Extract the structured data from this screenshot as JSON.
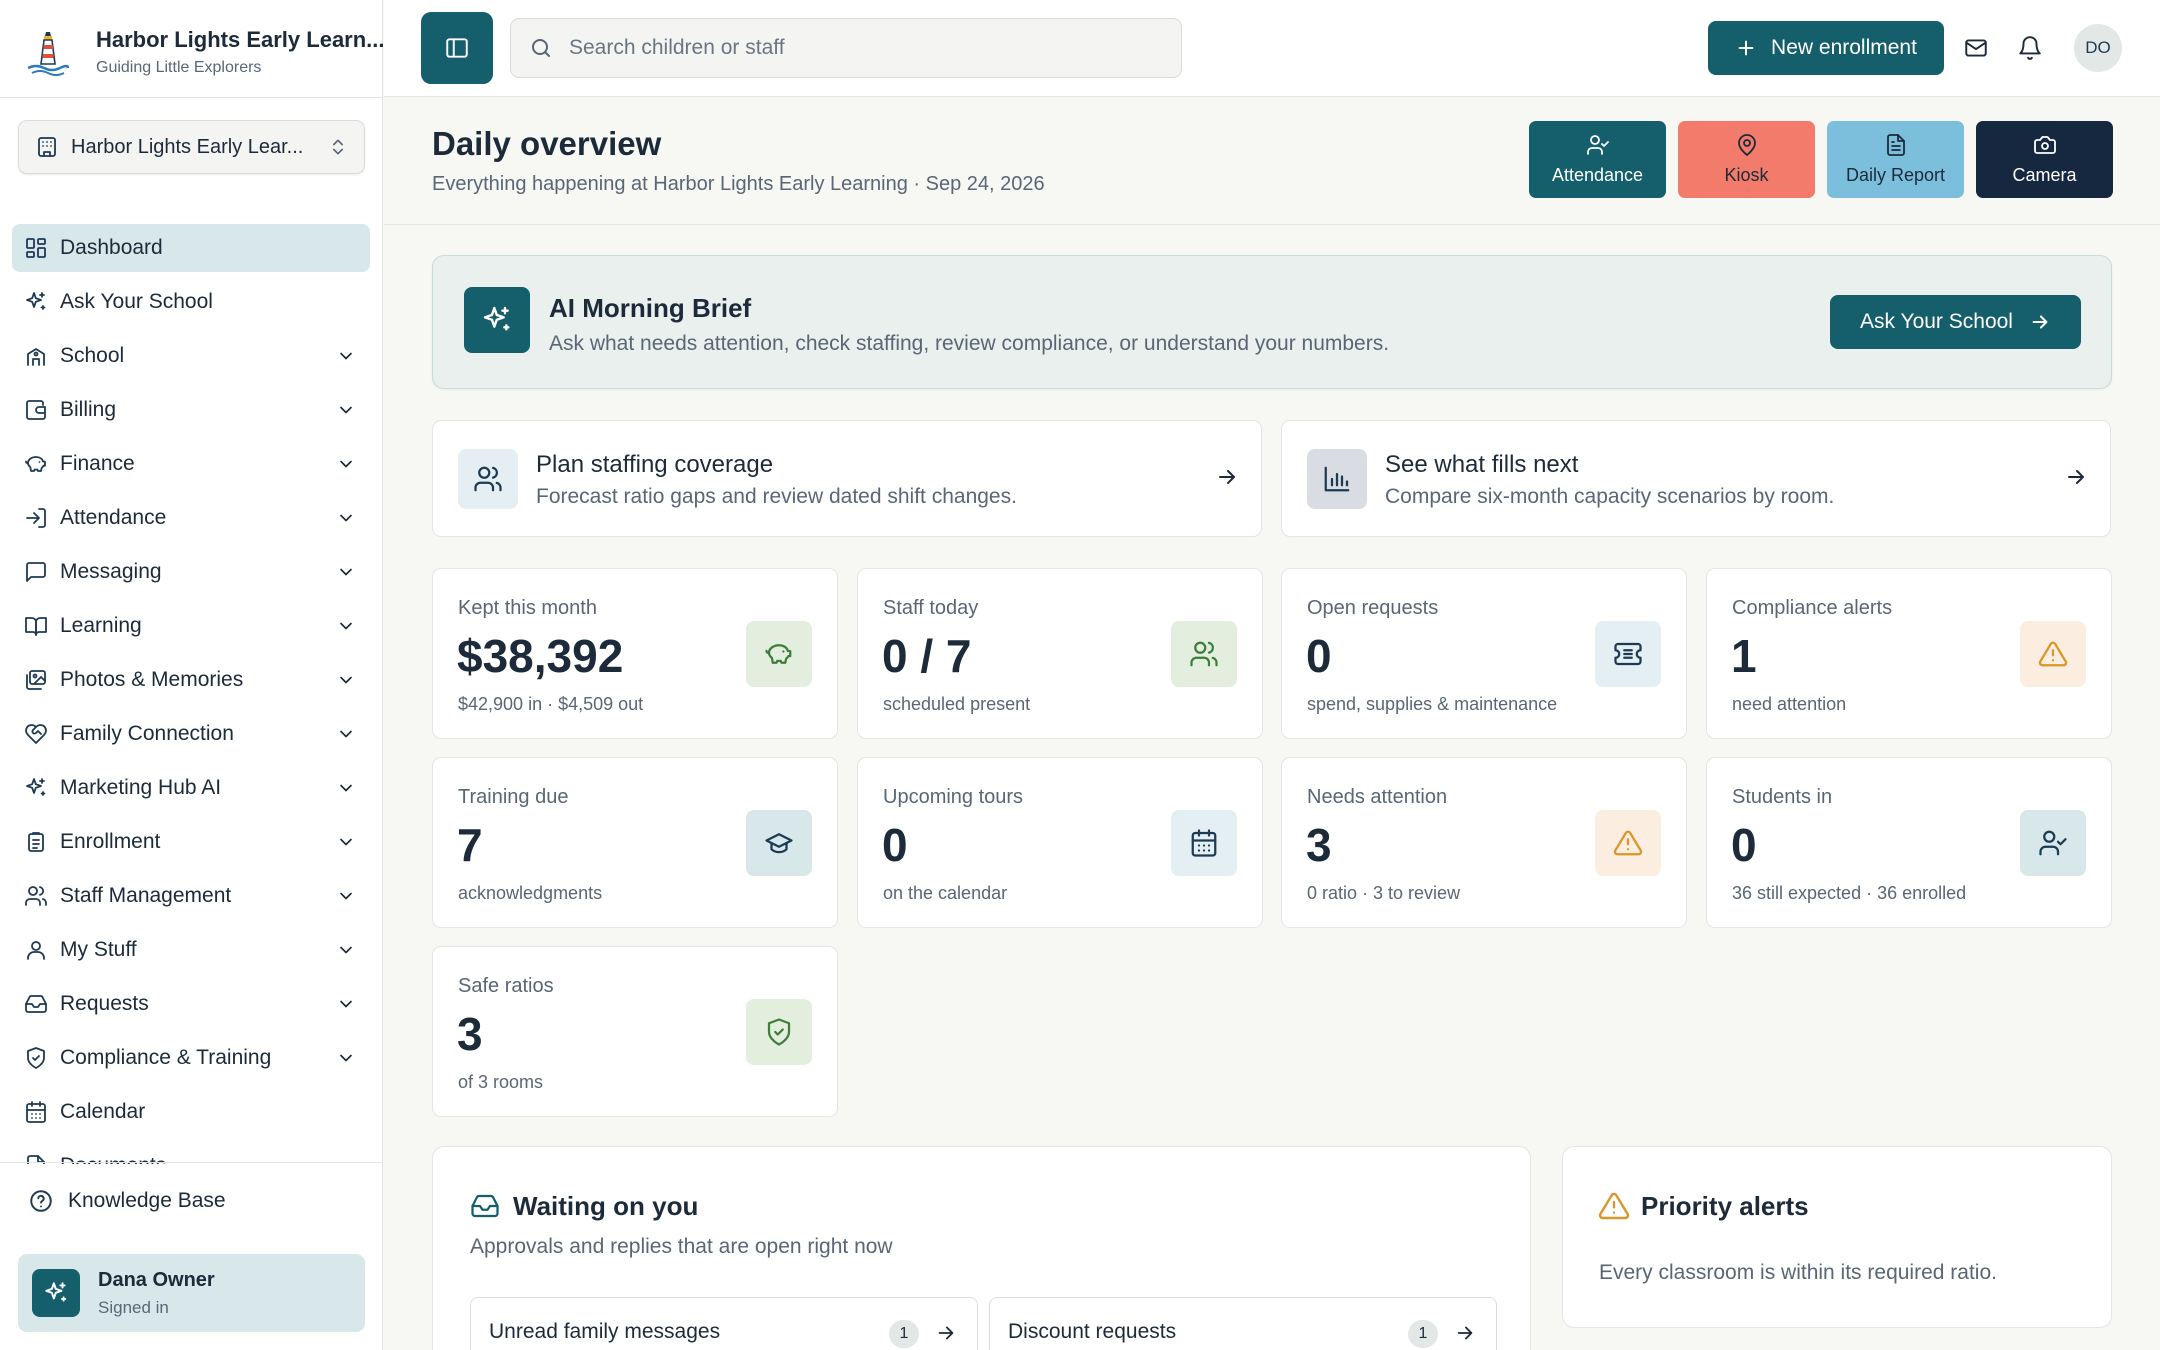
{
  "brand": {
    "name": "Harbor Lights Early Learn...",
    "tagline": "Guiding Little Explorers"
  },
  "school_selector": {
    "label": "Harbor Lights Early Lear..."
  },
  "sidebar": {
    "items": [
      {
        "label": "Dashboard",
        "icon": "dashboard-icon",
        "active": true,
        "expandable": false
      },
      {
        "label": "Ask Your School",
        "icon": "sparkles-icon",
        "expandable": false
      },
      {
        "label": "School",
        "icon": "school-icon",
        "expandable": true
      },
      {
        "label": "Billing",
        "icon": "wallet-icon",
        "expandable": true
      },
      {
        "label": "Finance",
        "icon": "piggy-bank-icon",
        "expandable": true
      },
      {
        "label": "Attendance",
        "icon": "login-icon",
        "expandable": true
      },
      {
        "label": "Messaging",
        "icon": "message-square-icon",
        "expandable": true
      },
      {
        "label": "Learning",
        "icon": "book-open-icon",
        "expandable": true
      },
      {
        "label": "Photos & Memories",
        "icon": "images-icon",
        "expandable": true
      },
      {
        "label": "Family Connection",
        "icon": "heart-handshake-icon",
        "expandable": true
      },
      {
        "label": "Marketing Hub AI",
        "icon": "sparkles-icon",
        "expandable": true
      },
      {
        "label": "Enrollment",
        "icon": "clipboard-icon",
        "expandable": true
      },
      {
        "label": "Staff Management",
        "icon": "users-icon",
        "expandable": true
      },
      {
        "label": "My Stuff",
        "icon": "user-icon",
        "expandable": true
      },
      {
        "label": "Requests",
        "icon": "inbox-icon",
        "expandable": true
      },
      {
        "label": "Compliance & Training",
        "icon": "shield-check-icon",
        "expandable": true
      },
      {
        "label": "Calendar",
        "icon": "calendar-icon",
        "expandable": false
      },
      {
        "label": "Documents",
        "icon": "file-icon",
        "expandable": false
      }
    ],
    "knowledge_base": "Knowledge Base",
    "user": {
      "name": "Dana Owner",
      "status": "Signed in"
    }
  },
  "topbar": {
    "search_placeholder": "Search children or staff",
    "new_enrollment": "New enrollment",
    "avatar_initials": "DO"
  },
  "header": {
    "title": "Daily overview",
    "subtitle": "Everything happening at Harbor Lights Early Learning · Sep 24, 2026",
    "quick_actions": [
      {
        "label": "Attendance",
        "icon": "user-check-icon",
        "bg": "#155e6b",
        "fg": "#ffffff"
      },
      {
        "label": "Kiosk",
        "icon": "map-pin-icon",
        "bg": "#f37b6b",
        "fg": "#1d2a3a"
      },
      {
        "label": "Daily Report",
        "icon": "file-text-icon",
        "bg": "#7cbfdc",
        "fg": "#1d2a3a"
      },
      {
        "label": "Camera",
        "icon": "camera-icon",
        "bg": "#162840",
        "fg": "#ffffff"
      }
    ]
  },
  "brief": {
    "title": "AI Morning Brief",
    "subtitle": "Ask what needs attention, check staffing, review compliance, or understand your numbers.",
    "button": "Ask Your School"
  },
  "link_cards": [
    {
      "title": "Plan staffing coverage",
      "subtitle": "Forecast ratio gaps and review dated shift changes.",
      "icon": "users-icon",
      "icon_bg": "#e5eef3"
    },
    {
      "title": "See what fills next",
      "subtitle": "Compare six-month capacity scenarios by room.",
      "icon": "bar-chart-icon",
      "icon_bg": "#d9dde3"
    }
  ],
  "stats": [
    {
      "label": "Kept this month",
      "value": "$38,392",
      "sub": "$42,900 in · $4,509 out",
      "icon": "piggy-bank-icon",
      "icon_bg": "#e3eedf",
      "icon_color": "#3f7d3a"
    },
    {
      "label": "Staff today",
      "value": "0 / 7",
      "sub": "scheduled present",
      "icon": "users-icon",
      "icon_bg": "#e3eedf",
      "icon_color": "#3f7d3a"
    },
    {
      "label": "Open requests",
      "value": "0",
      "sub": "spend, supplies & maintenance",
      "icon": "ticket-icon",
      "icon_bg": "#e4eff4",
      "icon_color": "#1d3a55"
    },
    {
      "label": "Compliance alerts",
      "value": "1",
      "sub": "need attention",
      "icon": "alert-triangle-icon",
      "icon_bg": "#fbeee0",
      "icon_color": "#d9962b"
    },
    {
      "label": "Training due",
      "value": "7",
      "sub": "acknowledgments",
      "icon": "graduation-cap-icon",
      "icon_bg": "#d8e7ea",
      "icon_color": "#1d3a55"
    },
    {
      "label": "Upcoming tours",
      "value": "0",
      "sub": "on the calendar",
      "icon": "calendar-icon",
      "icon_bg": "#e4eff4",
      "icon_color": "#1d3a55"
    },
    {
      "label": "Needs attention",
      "value": "3",
      "sub": "0 ratio · 3 to review",
      "icon": "alert-triangle-icon",
      "icon_bg": "#fbeee0",
      "icon_color": "#d9962b"
    },
    {
      "label": "Students in",
      "value": "0",
      "sub": "36 still expected · 36 enrolled",
      "icon": "user-check-icon",
      "icon_bg": "#d8e7ea",
      "icon_color": "#1d3a55"
    },
    {
      "label": "Safe ratios",
      "value": "3",
      "sub": "of 3 rooms",
      "icon": "shield-check-icon",
      "icon_bg": "#e3eedf",
      "icon_color": "#3f7d3a"
    }
  ],
  "waiting": {
    "title": "Waiting on you",
    "subtitle": "Approvals and replies that are open right now",
    "rows": [
      {
        "label": "Unread family messages",
        "count": "1"
      },
      {
        "label": "Discount requests",
        "count": "1"
      }
    ]
  },
  "priority": {
    "title": "Priority alerts",
    "message": "Every classroom is within its required ratio."
  },
  "colors": {
    "brand": "#155e6b",
    "background": "#f7f7f4",
    "text": "#1d2a3a",
    "muted": "#5a6675",
    "warning": "#d9962b",
    "success": "#3f7d3a"
  }
}
